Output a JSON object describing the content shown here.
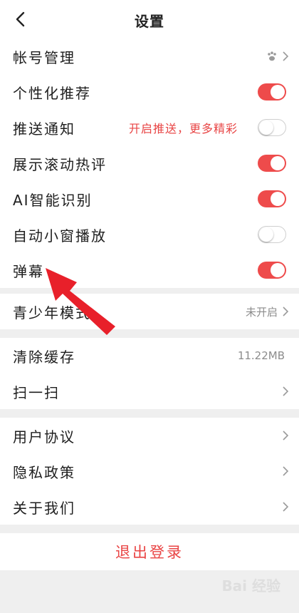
{
  "header": {
    "title": "设置"
  },
  "section1": [
    {
      "label": "帐号管理",
      "kind": "link",
      "icon": "paw-icon"
    },
    {
      "label": "个性化推荐",
      "kind": "toggle",
      "on": true
    },
    {
      "label": "推送通知",
      "kind": "toggle",
      "on": false,
      "hint": "开启推送，更多精彩"
    },
    {
      "label": "展示滚动热评",
      "kind": "toggle",
      "on": true
    },
    {
      "label": "AI智能识别",
      "kind": "toggle",
      "on": true
    },
    {
      "label": "自动小窗播放",
      "kind": "toggle",
      "on": false
    },
    {
      "label": "弹幕",
      "kind": "toggle",
      "on": true
    }
  ],
  "section2": [
    {
      "label": "青少年模式",
      "value": "未开启"
    }
  ],
  "section3": [
    {
      "label": "清除缓存",
      "value": "11.22MB"
    },
    {
      "label": "扫一扫"
    }
  ],
  "section4": [
    {
      "label": "用户协议"
    },
    {
      "label": "隐私政策"
    },
    {
      "label": "关于我们"
    }
  ],
  "logout_label": "退出登录",
  "watermark": "Bai 经验",
  "colors": {
    "accent": "#ee4b4b",
    "annotation_arrow": "#e8202a"
  }
}
